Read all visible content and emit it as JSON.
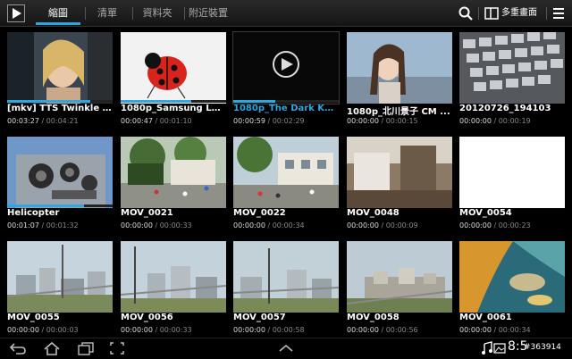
{
  "tabs": [
    {
      "label": "縮圖",
      "active": true
    },
    {
      "label": "清單",
      "active": false
    },
    {
      "label": "資料夾",
      "active": false
    },
    {
      "label": "附近裝置",
      "active": false
    }
  ],
  "toolbar": {
    "multi_label": "多重畫面"
  },
  "videos": [
    {
      "title": "[mkv] TTS Twinkle Full...",
      "current": "00:03:27",
      "total": "00:04:21",
      "progress": 0.79
    },
    {
      "title": "1080p_Samsung LED ...",
      "current": "00:00:47",
      "total": "00:01:10",
      "progress": 0.67
    },
    {
      "title": "1080p_The Dark Knight...",
      "current": "00:00:59",
      "total": "00:02:29",
      "progress": 0.4,
      "highlighted": true
    },
    {
      "title": "1080p_北川景子 CM ...",
      "current": "00:00:00",
      "total": "00:00:15",
      "progress": 0
    },
    {
      "title": "20120726_194103",
      "current": "00:00:00",
      "total": "00:00:19",
      "progress": 0
    },
    {
      "title": "Helicopter",
      "current": "00:01:07",
      "total": "00:01:32",
      "progress": 0.73
    },
    {
      "title": "MOV_0021",
      "current": "00:00:00",
      "total": "00:00:33",
      "progress": 0
    },
    {
      "title": "MOV_0022",
      "current": "00:00:00",
      "total": "00:00:34",
      "progress": 0
    },
    {
      "title": "MOV_0048",
      "current": "00:00:00",
      "total": "00:00:09",
      "progress": 0
    },
    {
      "title": "MOV_0054",
      "current": "00:00:00",
      "total": "00:00:23",
      "progress": 0
    },
    {
      "title": "MOV_0055",
      "current": "00:00:00",
      "total": "00:00:03",
      "progress": 0
    },
    {
      "title": "MOV_0056",
      "current": "00:00:00",
      "total": "00:00:33",
      "progress": 0
    },
    {
      "title": "MOV_0057",
      "current": "00:00:00",
      "total": "00:00:58",
      "progress": 0
    },
    {
      "title": "MOV_0058",
      "current": "00:00:00",
      "total": "00:00:56",
      "progress": 0
    },
    {
      "title": "MOV_0061",
      "current": "00:00:00",
      "total": "00:00:34",
      "progress": 0
    }
  ],
  "status": {
    "time": "8:5",
    "watermark": "#363914"
  },
  "colors": {
    "accent": "#2fa6df"
  }
}
